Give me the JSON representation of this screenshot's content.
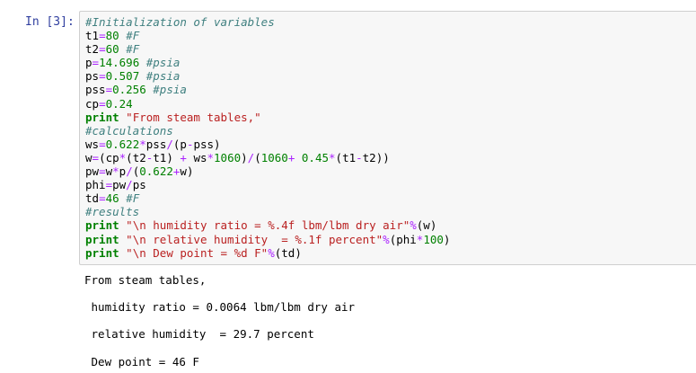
{
  "cell": {
    "prompt": "In [3]:",
    "input_lines": [
      [
        {
          "t": "c",
          "v": "#Initialization of variables"
        }
      ],
      [
        {
          "t": "n",
          "v": "t1"
        },
        {
          "t": "o",
          "v": "="
        },
        {
          "t": "m",
          "v": "80"
        },
        {
          "t": "n",
          "v": " "
        },
        {
          "t": "c",
          "v": "#F"
        }
      ],
      [
        {
          "t": "n",
          "v": "t2"
        },
        {
          "t": "o",
          "v": "="
        },
        {
          "t": "m",
          "v": "60"
        },
        {
          "t": "n",
          "v": " "
        },
        {
          "t": "c",
          "v": "#F"
        }
      ],
      [
        {
          "t": "n",
          "v": "p"
        },
        {
          "t": "o",
          "v": "="
        },
        {
          "t": "m",
          "v": "14.696"
        },
        {
          "t": "n",
          "v": " "
        },
        {
          "t": "c",
          "v": "#psia"
        }
      ],
      [
        {
          "t": "n",
          "v": "ps"
        },
        {
          "t": "o",
          "v": "="
        },
        {
          "t": "m",
          "v": "0.507"
        },
        {
          "t": "n",
          "v": " "
        },
        {
          "t": "c",
          "v": "#psia"
        }
      ],
      [
        {
          "t": "n",
          "v": "pss"
        },
        {
          "t": "o",
          "v": "="
        },
        {
          "t": "m",
          "v": "0.256"
        },
        {
          "t": "n",
          "v": " "
        },
        {
          "t": "c",
          "v": "#psia"
        }
      ],
      [
        {
          "t": "n",
          "v": "cp"
        },
        {
          "t": "o",
          "v": "="
        },
        {
          "t": "m",
          "v": "0.24"
        }
      ],
      [
        {
          "t": "k",
          "v": "print"
        },
        {
          "t": "n",
          "v": " "
        },
        {
          "t": "s",
          "v": "\"From steam tables,\""
        }
      ],
      [
        {
          "t": "c",
          "v": "#calculations"
        }
      ],
      [
        {
          "t": "n",
          "v": "ws"
        },
        {
          "t": "o",
          "v": "="
        },
        {
          "t": "m",
          "v": "0.622"
        },
        {
          "t": "o",
          "v": "*"
        },
        {
          "t": "n",
          "v": "pss"
        },
        {
          "t": "o",
          "v": "/"
        },
        {
          "t": "n",
          "v": "(p"
        },
        {
          "t": "o",
          "v": "-"
        },
        {
          "t": "n",
          "v": "pss)"
        }
      ],
      [
        {
          "t": "n",
          "v": "w"
        },
        {
          "t": "o",
          "v": "="
        },
        {
          "t": "n",
          "v": "(cp"
        },
        {
          "t": "o",
          "v": "*"
        },
        {
          "t": "n",
          "v": "(t2"
        },
        {
          "t": "o",
          "v": "-"
        },
        {
          "t": "n",
          "v": "t1) "
        },
        {
          "t": "o",
          "v": "+"
        },
        {
          "t": "n",
          "v": " ws"
        },
        {
          "t": "o",
          "v": "*"
        },
        {
          "t": "m",
          "v": "1060"
        },
        {
          "t": "n",
          "v": ")"
        },
        {
          "t": "o",
          "v": "/"
        },
        {
          "t": "n",
          "v": "("
        },
        {
          "t": "m",
          "v": "1060"
        },
        {
          "t": "o",
          "v": "+"
        },
        {
          "t": "n",
          "v": " "
        },
        {
          "t": "m",
          "v": "0.45"
        },
        {
          "t": "o",
          "v": "*"
        },
        {
          "t": "n",
          "v": "(t1"
        },
        {
          "t": "o",
          "v": "-"
        },
        {
          "t": "n",
          "v": "t2))"
        }
      ],
      [
        {
          "t": "n",
          "v": "pw"
        },
        {
          "t": "o",
          "v": "="
        },
        {
          "t": "n",
          "v": "w"
        },
        {
          "t": "o",
          "v": "*"
        },
        {
          "t": "n",
          "v": "p"
        },
        {
          "t": "o",
          "v": "/"
        },
        {
          "t": "n",
          "v": "("
        },
        {
          "t": "m",
          "v": "0.622"
        },
        {
          "t": "o",
          "v": "+"
        },
        {
          "t": "n",
          "v": "w)"
        }
      ],
      [
        {
          "t": "n",
          "v": "phi"
        },
        {
          "t": "o",
          "v": "="
        },
        {
          "t": "n",
          "v": "pw"
        },
        {
          "t": "o",
          "v": "/"
        },
        {
          "t": "n",
          "v": "ps"
        }
      ],
      [
        {
          "t": "n",
          "v": "td"
        },
        {
          "t": "o",
          "v": "="
        },
        {
          "t": "m",
          "v": "46"
        },
        {
          "t": "n",
          "v": " "
        },
        {
          "t": "c",
          "v": "#F"
        }
      ],
      [
        {
          "t": "c",
          "v": "#results"
        }
      ],
      [
        {
          "t": "k",
          "v": "print"
        },
        {
          "t": "n",
          "v": " "
        },
        {
          "t": "s",
          "v": "\"\\n humidity ratio = %.4f lbm/lbm dry air\""
        },
        {
          "t": "o",
          "v": "%"
        },
        {
          "t": "n",
          "v": "(w)"
        }
      ],
      [
        {
          "t": "k",
          "v": "print"
        },
        {
          "t": "n",
          "v": " "
        },
        {
          "t": "s",
          "v": "\"\\n relative humidity  = %.1f percent\""
        },
        {
          "t": "o",
          "v": "%"
        },
        {
          "t": "n",
          "v": "(phi"
        },
        {
          "t": "o",
          "v": "*"
        },
        {
          "t": "m",
          "v": "100"
        },
        {
          "t": "n",
          "v": ")"
        }
      ],
      [
        {
          "t": "k",
          "v": "print"
        },
        {
          "t": "n",
          "v": " "
        },
        {
          "t": "s",
          "v": "\"\\n Dew point = %d F\""
        },
        {
          "t": "o",
          "v": "%"
        },
        {
          "t": "n",
          "v": "(td)"
        }
      ]
    ],
    "output": {
      "line1": "From steam tables,",
      "line2": " humidity ratio = 0.0064 lbm/lbm dry air",
      "line3": " relative humidity  = 29.7 percent",
      "line4": " Dew point = 46 F"
    }
  },
  "colors": {
    "prompt": "#303f9f",
    "cell_background": "#f7f7f7",
    "cell_border": "#cfcfcf",
    "comment": "#408080",
    "keyword": "#008000",
    "string": "#ba2121",
    "number": "#008000",
    "operator": "#aa22ff"
  }
}
